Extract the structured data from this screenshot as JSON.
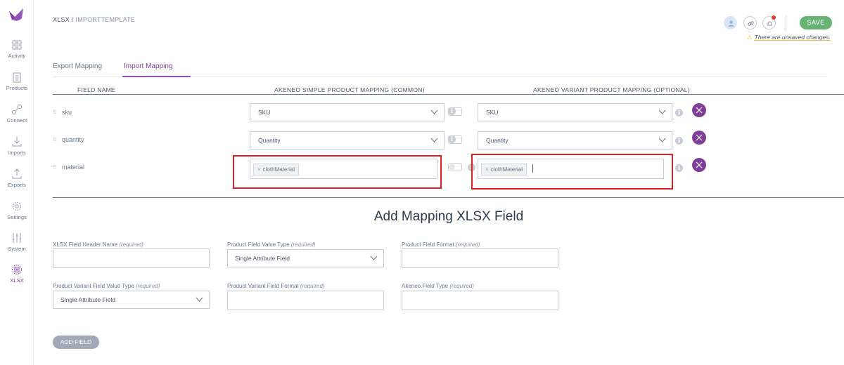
{
  "sidebar": {
    "items": [
      {
        "label": "Activity",
        "icon": "grid-icon"
      },
      {
        "label": "Products",
        "icon": "clipboard-icon"
      },
      {
        "label": "Connect",
        "icon": "connect-icon"
      },
      {
        "label": "Imports",
        "icon": "import-icon"
      },
      {
        "label": "Exports",
        "icon": "export-icon"
      },
      {
        "label": "Settings",
        "icon": "settings-icon"
      },
      {
        "label": "System",
        "icon": "sliders-icon"
      },
      {
        "label": "XLSX",
        "icon": "xlsx-icon",
        "active": true
      }
    ]
  },
  "breadcrumb": {
    "root": "XLSX",
    "separator": "/",
    "current": "IMPORTTEMPLATE"
  },
  "header": {
    "save_label": "SAVE",
    "unsaved_text": "There are unsaved changes.",
    "accent_color": "#67b373"
  },
  "tabs": [
    {
      "label": "Export Mapping",
      "active": false
    },
    {
      "label": "Import Mapping",
      "active": true
    }
  ],
  "table": {
    "headers": {
      "field_name": "FIELD NAME",
      "simple": "AKENEO SIMPLE PRODUCT MAPPING (COMMON)",
      "variant": "AKENEO VARIANT PRODUCT MAPPING (OPTIONAL)"
    },
    "rows": [
      {
        "field": "sku",
        "simple": "SKU",
        "variant": "SKU"
      },
      {
        "field": "quantity",
        "simple": "Quantity",
        "variant": "Quantity"
      },
      {
        "field": "material",
        "simple_tag": "clothMaterial",
        "variant_tag": "clothMaterial"
      }
    ]
  },
  "form": {
    "title": "Add Mapping XLSX Field",
    "required": "(required)",
    "fields": {
      "header_name": "XLSX Field Header Name",
      "value_type": "Product Field Value Type",
      "format": "Product Field Format",
      "variant_value_type": "Product Variant Field Value Type",
      "variant_format": "Product Variant Field Format",
      "akeneo_type": "Akeneo Field Type"
    },
    "value_type_selected": "Single Attribute Field",
    "variant_value_type_selected": "Single Attribute Field",
    "add_button": "ADD FIELD"
  },
  "colors": {
    "brand": "#7f3f98",
    "highlight_box": "#e02020"
  }
}
